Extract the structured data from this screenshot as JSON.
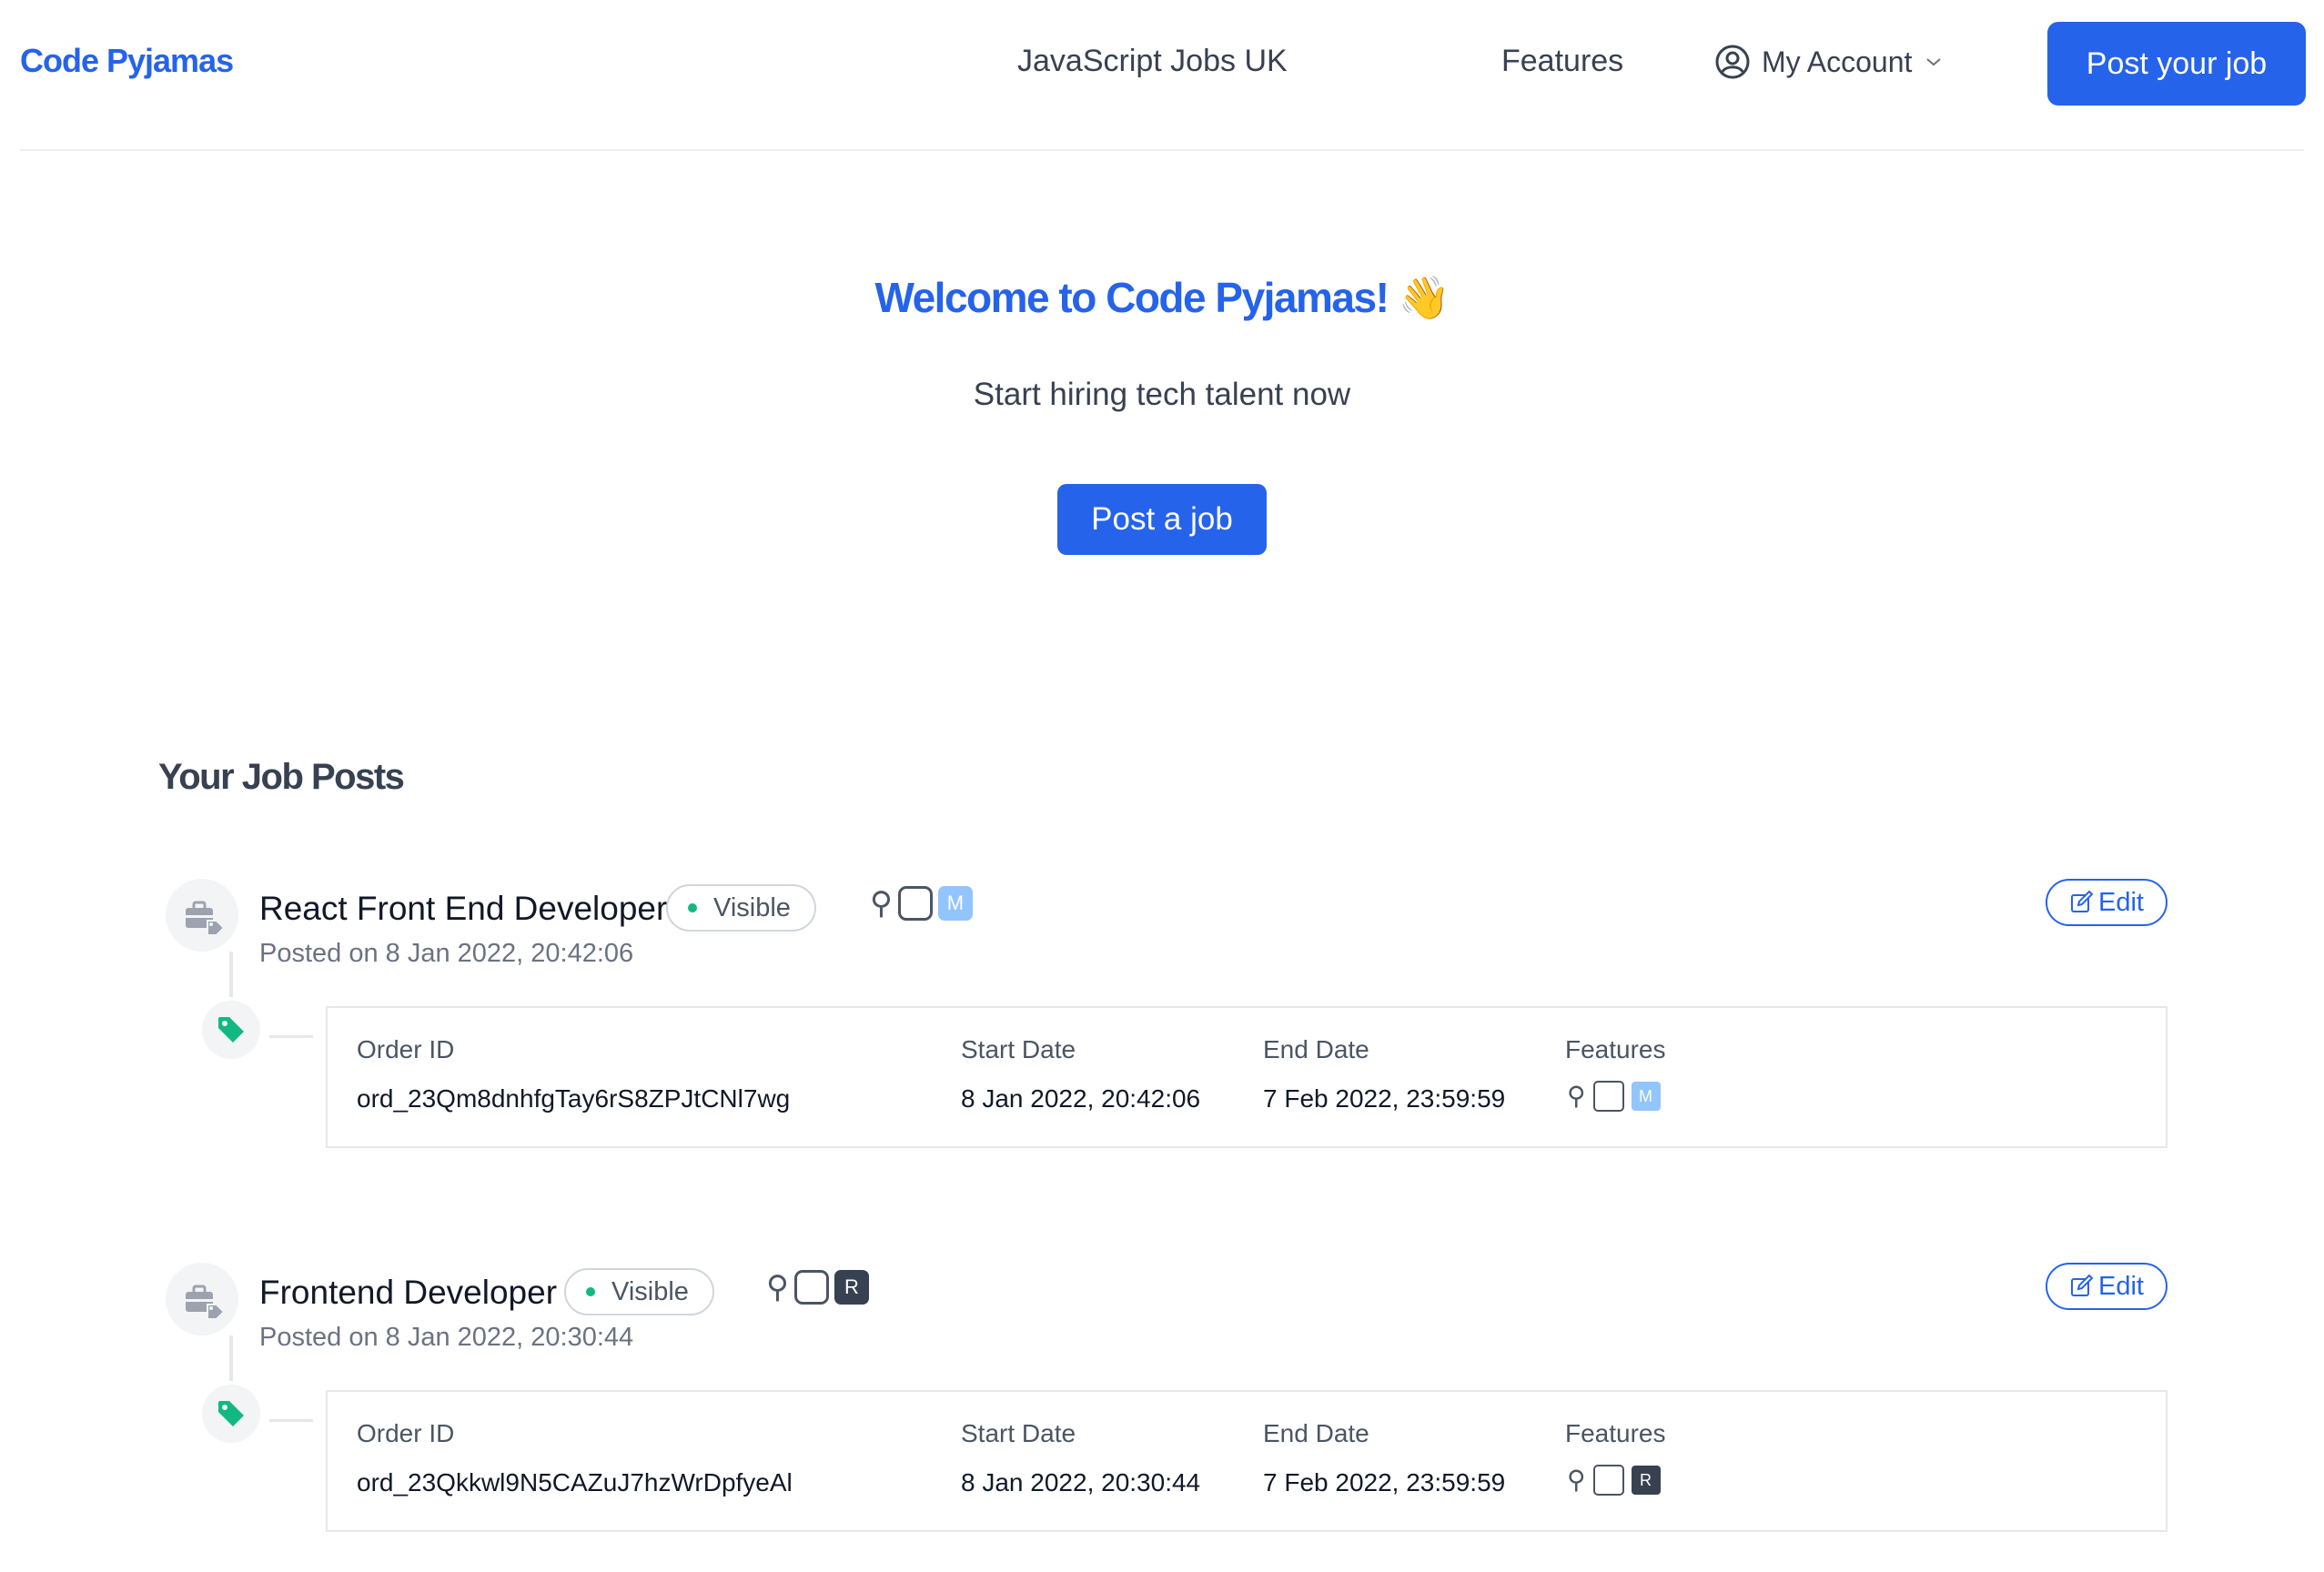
{
  "header": {
    "logo": "Code Pyjamas",
    "nav_jobs": "JavaScript Jobs UK",
    "nav_features": "Features",
    "account_label": "My Account",
    "post_job_button": "Post your job"
  },
  "hero": {
    "title": "Welcome to Code Pyjamas! 👋",
    "subtitle": "Start hiring tech talent now",
    "button": "Post a job"
  },
  "section_title": "Your Job Posts",
  "labels": {
    "visible": "Visible",
    "edit": "Edit",
    "order_id": "Order ID",
    "start_date": "Start Date",
    "end_date": "End Date",
    "features": "Features"
  },
  "colors": {
    "accent": "#2563eb",
    "visible_dot": "#10b981",
    "tag_green": "#10b981",
    "feature_m": "#93c5fd",
    "feature_r": "#374151"
  },
  "jobs": [
    {
      "title": "React Front End Developer",
      "posted": "Posted on 8 Jan 2022, 20:42:06",
      "feature_letter": "M",
      "order_id": "ord_23Qm8dnhfgTay6rS8ZPJtCNl7wg",
      "start_date": "8 Jan 2022, 20:42:06",
      "end_date": "7 Feb 2022, 23:59:59"
    },
    {
      "title": "Frontend Developer",
      "posted": "Posted on 8 Jan 2022, 20:30:44",
      "feature_letter": "R",
      "order_id": "ord_23Qkkwl9N5CAZuJ7hzWrDpfyeAl",
      "start_date": "8 Jan 2022, 20:30:44",
      "end_date": "7 Feb 2022, 23:59:59"
    }
  ]
}
